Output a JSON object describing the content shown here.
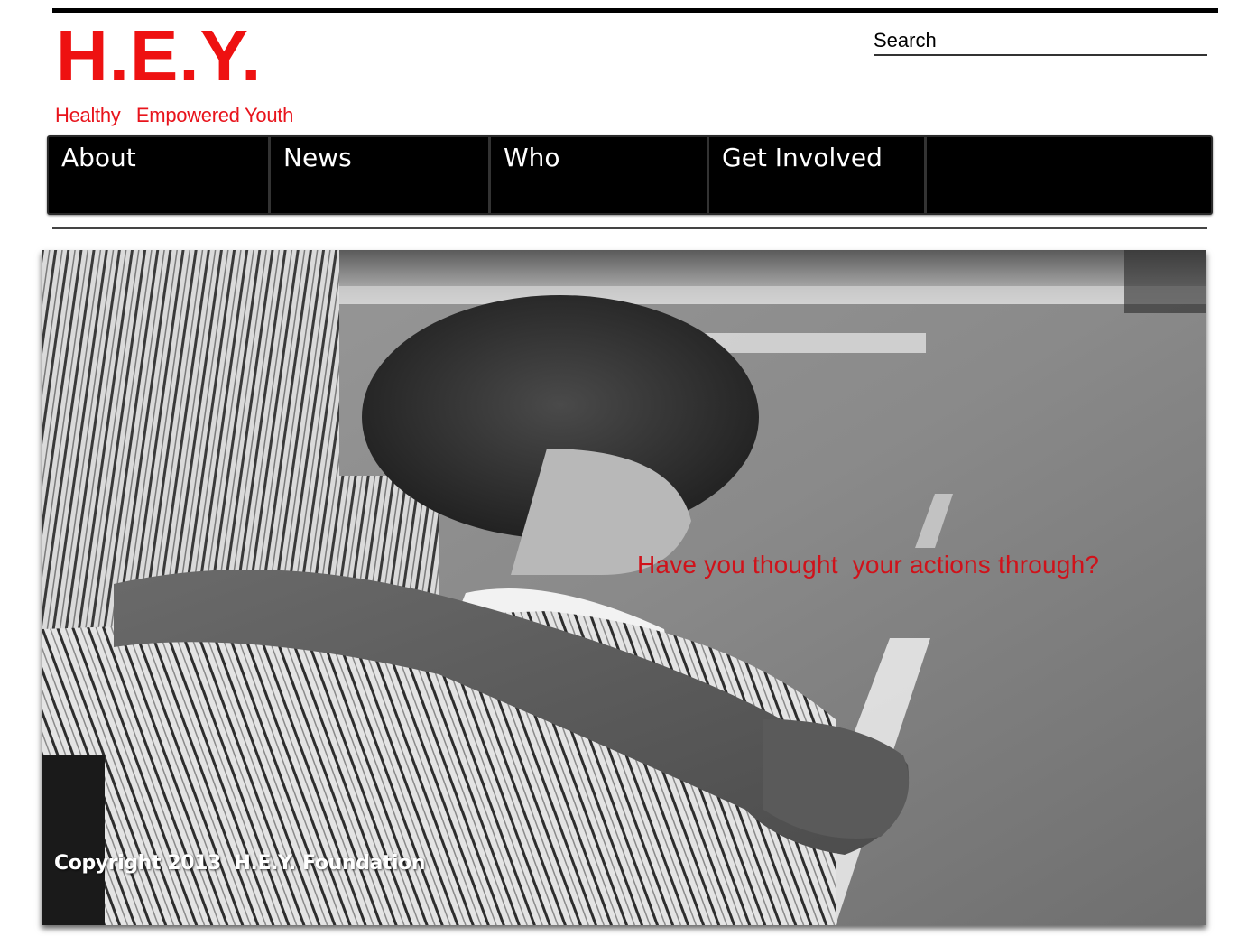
{
  "brand": {
    "logo_text": "H.E.Y.",
    "tagline": "Healthy   Empowered Youth",
    "accent_color": "#ee1111"
  },
  "search": {
    "placeholder": "Search"
  },
  "nav": {
    "items": [
      {
        "label": "About"
      },
      {
        "label": "News"
      },
      {
        "label": "Who"
      },
      {
        "label": "Get Involved"
      },
      {
        "label": ""
      }
    ]
  },
  "hero": {
    "quote": "Have you thought  your actions through?",
    "quote_color": "#d0121a",
    "image_subject": "black-and-white photo of an adult with arm around a child near a road",
    "copyright": "Copyright 2013  H.E.Y. Foundation"
  }
}
